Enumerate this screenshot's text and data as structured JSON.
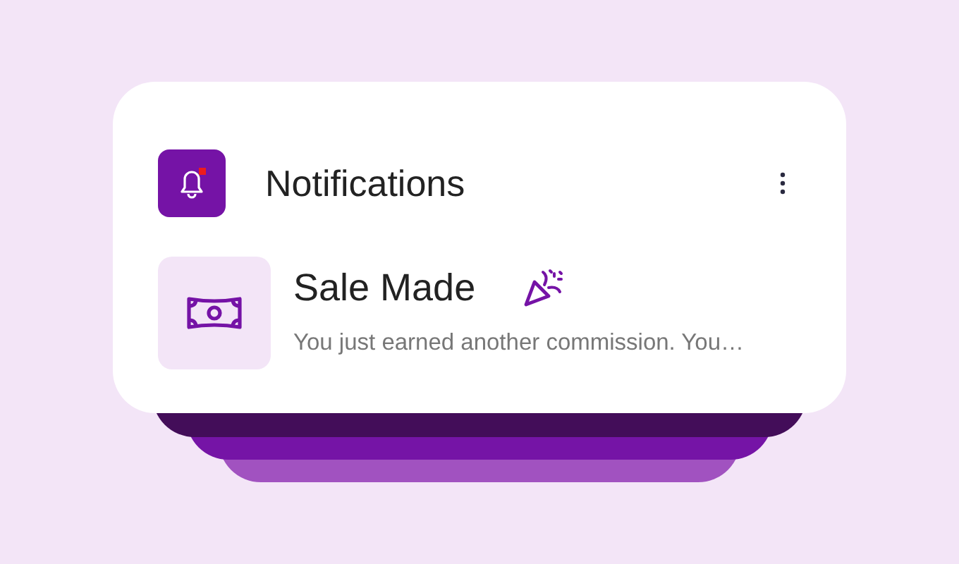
{
  "header": {
    "title": "Notifications"
  },
  "notifications": [
    {
      "title": "Sale Made",
      "message": "You just earned another commission. You…"
    }
  ]
}
